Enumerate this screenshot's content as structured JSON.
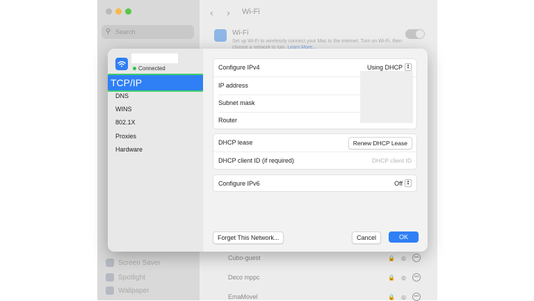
{
  "background_window": {
    "search_placeholder": "Search",
    "page_title": "Wi-Fi",
    "wifi_label": "Wi-Fi",
    "wifi_desc": "Set up Wi-Fi to wirelessly connect your Mac to the internet. Turn on Wi-Fi, then choose a network to join.",
    "learn_more": "Learn More...",
    "sidebar_items": [
      "Screen Saver",
      "Spotlight",
      "Wallpaper"
    ],
    "networks": [
      "Cubo-guest",
      "Deco mppc",
      "EmaMovel"
    ]
  },
  "sheet": {
    "status": "Connected",
    "nav": {
      "selected": "TCP/IP",
      "items": [
        "DNS",
        "WINS",
        "802.1X",
        "Proxies",
        "Hardware"
      ]
    },
    "ipv4": {
      "label": "Configure IPv4",
      "value": "Using DHCP",
      "ip_label": "IP address",
      "subnet_label": "Subnet mask",
      "router_label": "Router"
    },
    "dhcp": {
      "lease_label": "DHCP lease",
      "renew_button": "Renew DHCP Lease",
      "client_id_label": "DHCP client ID (if required)",
      "client_id_placeholder": "DHCP client ID"
    },
    "ipv6": {
      "label": "Configure IPv6",
      "value": "Off"
    },
    "footer": {
      "forget": "Forget This Network...",
      "cancel": "Cancel",
      "ok": "OK"
    }
  },
  "colors": {
    "accent": "#2f7ff5",
    "selection_outline": "#3ed06a",
    "connected_dot": "#31c24a"
  }
}
